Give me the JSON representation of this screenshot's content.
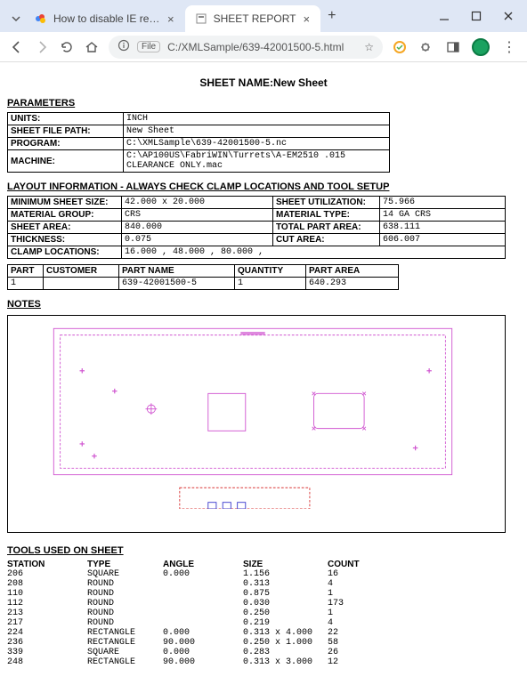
{
  "browser": {
    "tabs": [
      {
        "title": "How to disable IE redirect to Ed",
        "active": false
      },
      {
        "title": "SHEET REPORT",
        "active": true
      }
    ],
    "omnibox": {
      "file_label": "File",
      "url": "C:/XMLSample/639-42001500-5.html"
    }
  },
  "doc": {
    "title_label": "SHEET NAME:",
    "title_value": "New Sheet",
    "parameters_label": "PARAMETERS",
    "params": {
      "units": {
        "k": "UNITS:",
        "v": "INCH"
      },
      "sheet_file_path": {
        "k": "SHEET FILE PATH:",
        "v": "New Sheet"
      },
      "program": {
        "k": "PROGRAM:",
        "v": "C:\\XMLSample\\639-42001500-5.nc"
      },
      "machine": {
        "k": "MACHINE:",
        "v": "C:\\AP100US\\FabriWIN\\Turrets\\A-EM2510 .015 CLEARANCE ONLY.mac"
      }
    },
    "layout_header": "LAYOUT INFORMATION - ALWAYS CHECK CLAMP LOCATIONS AND TOOL SETUP",
    "layout": {
      "min_sheet_size": {
        "k": "MINIMUM SHEET SIZE:",
        "v": "42.000 x 20.000"
      },
      "sheet_util": {
        "k": "SHEET UTILIZATION:",
        "v": "75.966"
      },
      "material_group": {
        "k": "MATERIAL GROUP:",
        "v": "CRS"
      },
      "material_type": {
        "k": "MATERIAL TYPE:",
        "v": "14 GA CRS"
      },
      "sheet_area": {
        "k": "SHEET AREA:",
        "v": "840.000"
      },
      "total_part_area": {
        "k": "TOTAL PART AREA:",
        "v": "638.111"
      },
      "thickness": {
        "k": "THICKNESS:",
        "v": "0.075"
      },
      "cut_area": {
        "k": "CUT AREA:",
        "v": "606.007"
      },
      "clamp_locations": {
        "k": "CLAMP LOCATIONS:",
        "v": "16.000 , 48.000 , 80.000 ,"
      }
    },
    "parts_header": {
      "part": "PART",
      "customer": "CUSTOMER",
      "part_name": "PART NAME",
      "quantity": "QUANTITY",
      "part_area": "PART AREA"
    },
    "parts_row": {
      "part": "1",
      "customer": "",
      "part_name": "639-42001500-5",
      "quantity": "1",
      "part_area": "640.293"
    },
    "notes_label": "NOTES",
    "tools_header": "TOOLS USED ON SHEET",
    "tools_cols": {
      "station": "STATION",
      "type": "TYPE",
      "angle": "ANGLE",
      "size": "SIZE",
      "count": "COUNT"
    },
    "tools": [
      {
        "station": "206",
        "type": "SQUARE",
        "angle": "0.000",
        "size": "1.156",
        "count": "16"
      },
      {
        "station": "208",
        "type": "ROUND",
        "angle": "",
        "size": "0.313",
        "count": "4"
      },
      {
        "station": "110",
        "type": "ROUND",
        "angle": "",
        "size": "0.875",
        "count": "1"
      },
      {
        "station": "112",
        "type": "ROUND",
        "angle": "",
        "size": "0.030",
        "count": "173"
      },
      {
        "station": "213",
        "type": "ROUND",
        "angle": "",
        "size": "0.250",
        "count": "1"
      },
      {
        "station": "217",
        "type": "ROUND",
        "angle": "",
        "size": "0.219",
        "count": "4"
      },
      {
        "station": "224",
        "type": "RECTANGLE",
        "angle": "0.000",
        "size": "0.313 x 4.000",
        "count": "22"
      },
      {
        "station": "236",
        "type": "RECTANGLE",
        "angle": "90.000",
        "size": "0.250 x 1.000",
        "count": "58"
      },
      {
        "station": "339",
        "type": "SQUARE",
        "angle": "0.000",
        "size": "0.283",
        "count": "26"
      },
      {
        "station": "248",
        "type": "RECTANGLE",
        "angle": "90.000",
        "size": "0.313 x 3.000",
        "count": "12"
      }
    ]
  }
}
